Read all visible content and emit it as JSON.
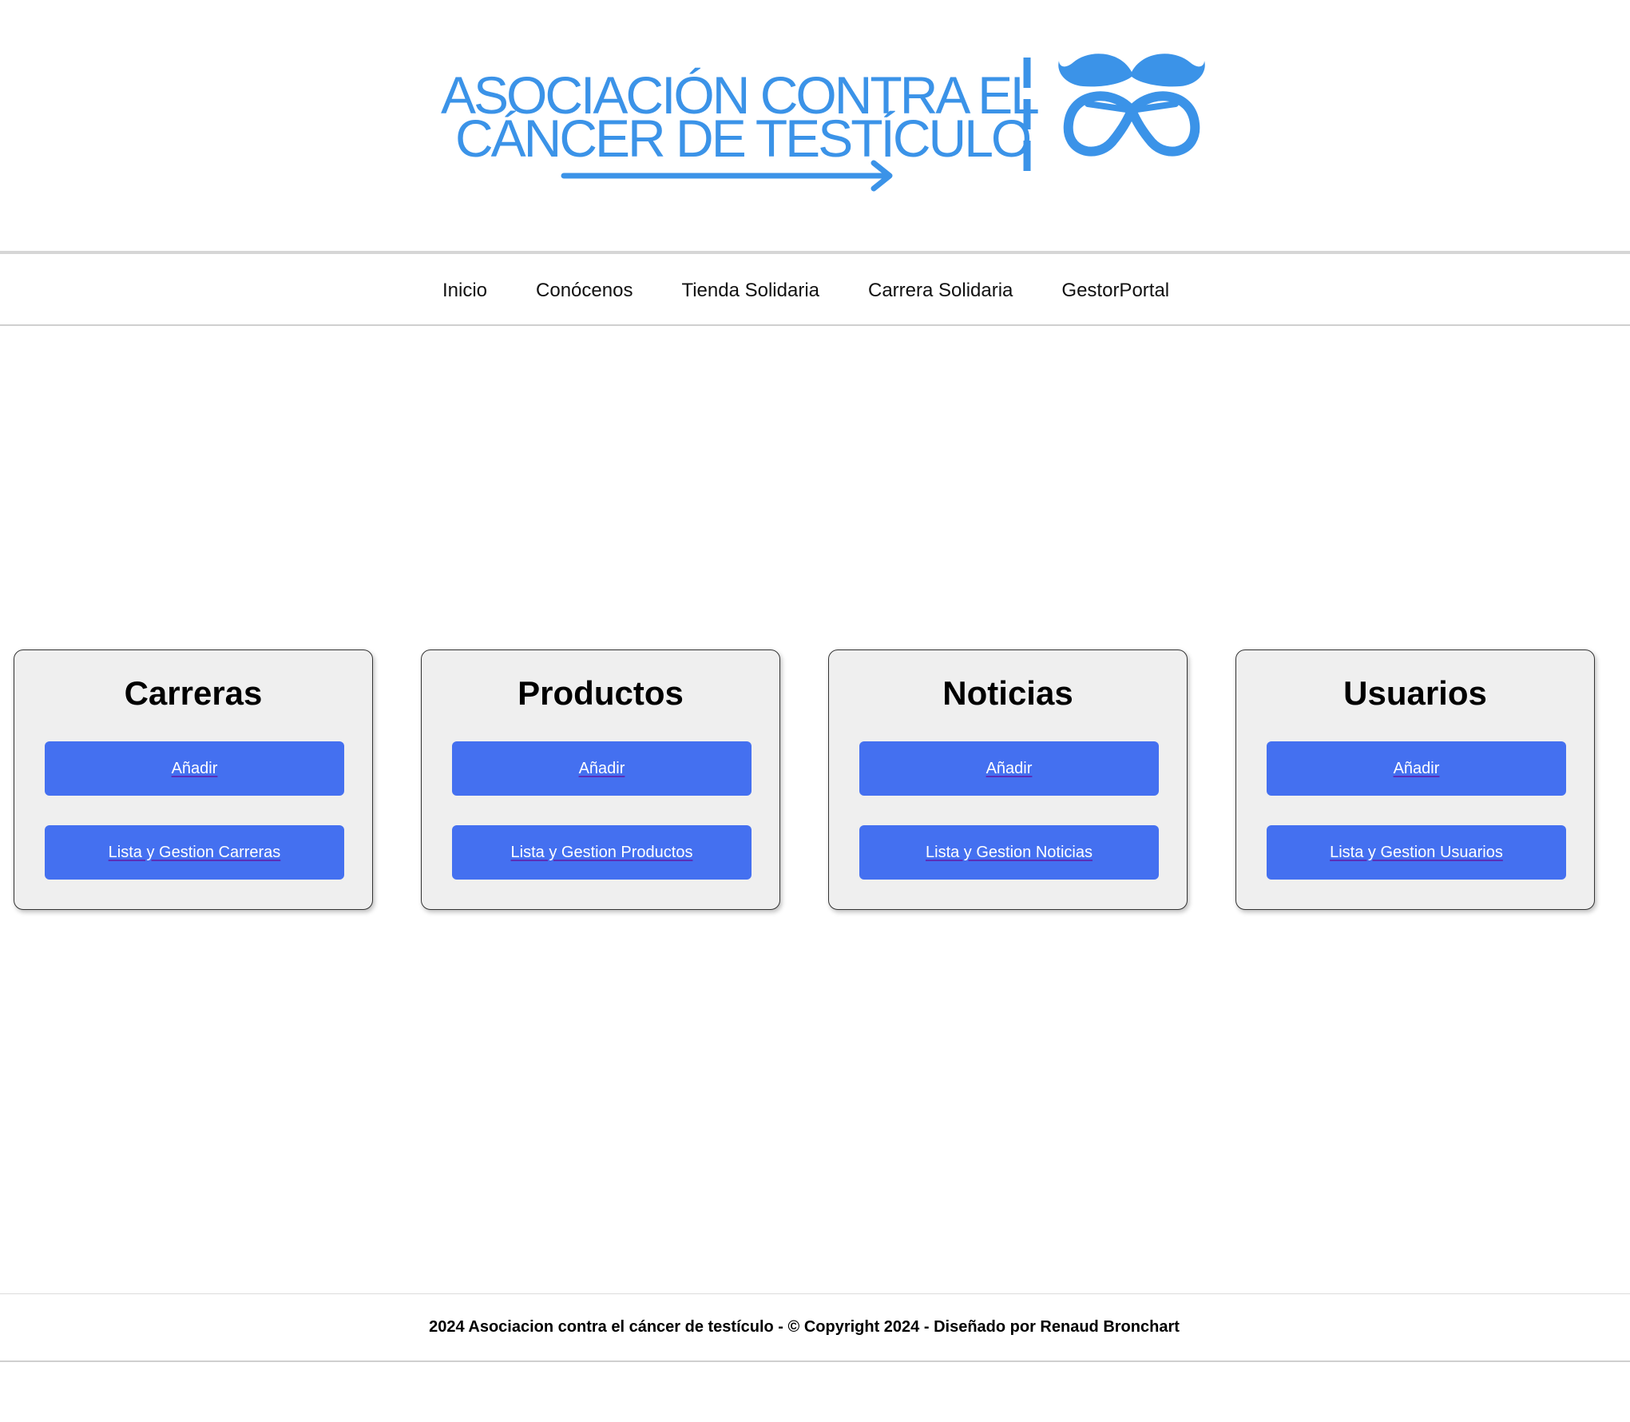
{
  "header": {
    "logo": {
      "line1": "ASOCIACIÓN CONTRA EL",
      "line2": "CÁNCER DE TESTÍCULO",
      "brand_color": "#3b93e8",
      "icons": [
        "arrow-right-icon",
        "mustache-icon"
      ]
    }
  },
  "nav": {
    "items": [
      {
        "label": "Inicio"
      },
      {
        "label": "Conócenos"
      },
      {
        "label": "Tienda Solidaria"
      },
      {
        "label": "Carrera Solidaria"
      },
      {
        "label": "GestorPortal"
      }
    ]
  },
  "cards": [
    {
      "title": "Carreras",
      "add_label": "Añadir",
      "list_label": "Lista y Gestion Carreras"
    },
    {
      "title": "Productos",
      "add_label": "Añadir",
      "list_label": "Lista y Gestion Productos"
    },
    {
      "title": "Noticias",
      "add_label": "Añadir",
      "list_label": "Lista y Gestion Noticias"
    },
    {
      "title": "Usuarios",
      "add_label": "Añadir",
      "list_label": "Lista y Gestion Usuarios"
    }
  ],
  "footer": {
    "text": "2024 Asociacion contra el cáncer de testículo - © Copyright 2024 - Diseñado por Renaud Bronchart"
  },
  "colors": {
    "button_bg": "#4470f0",
    "card_bg": "#efefef",
    "page_bg": "#ffffff"
  }
}
